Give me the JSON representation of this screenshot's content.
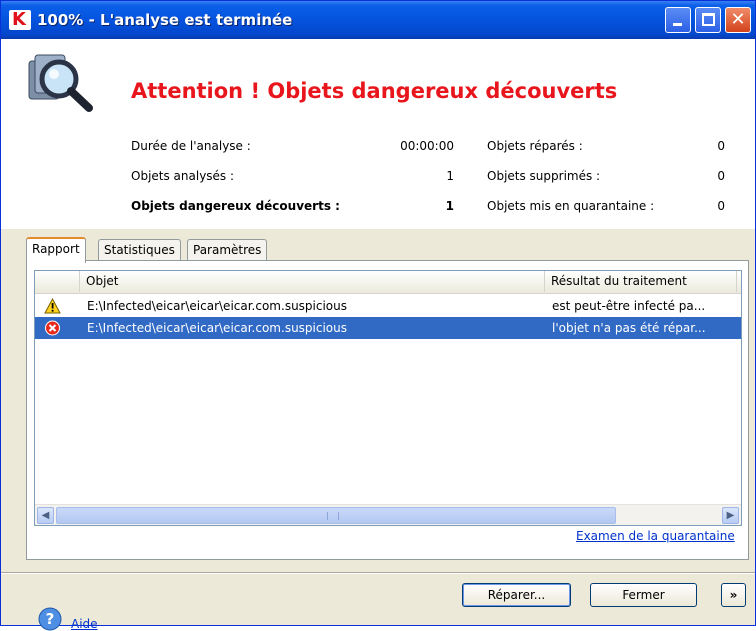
{
  "window": {
    "title": "100% - L'analyse est terminée",
    "logo_letter": "K"
  },
  "header": {
    "headline": "Attention ! Objets dangereux découverts"
  },
  "stats": {
    "left": [
      {
        "label": "Durée de l'analyse :",
        "value": "00:00:00",
        "bold": false
      },
      {
        "label": "Objets analysés :",
        "value": "1",
        "bold": false
      },
      {
        "label": "Objets dangereux découverts :",
        "value": "1",
        "bold": true
      }
    ],
    "right": [
      {
        "label": "Objets réparés :",
        "value": "0"
      },
      {
        "label": "Objets supprimés :",
        "value": "0"
      },
      {
        "label": "Objets mis en quarantaine :",
        "value": "0"
      }
    ]
  },
  "tabs": [
    {
      "label": "Rapport",
      "active": true
    },
    {
      "label": "Statistiques",
      "active": false
    },
    {
      "label": "Paramètres",
      "active": false
    }
  ],
  "report": {
    "columns": [
      "Objet",
      "Résultat du traitement"
    ],
    "rows": [
      {
        "icon": "warning-icon",
        "object": "E:\\Infected\\eicar\\eicar\\eicar.com.suspicious",
        "result": "est peut-être infecté pa...",
        "selected": false
      },
      {
        "icon": "error-icon",
        "object": "E:\\Infected\\eicar\\eicar\\eicar.com.suspicious",
        "result": "l'objet n'a pas été répar...",
        "selected": true
      }
    ]
  },
  "links": {
    "quarantine": "Examen de la quarantaine",
    "help": "Aide"
  },
  "buttons": {
    "repair": "Réparer...",
    "close": "Fermer",
    "expand": "»"
  },
  "colors": {
    "headline": "#e8161c",
    "titlebar": "#0553de",
    "selection": "#316ac5",
    "link": "#0033cc"
  }
}
